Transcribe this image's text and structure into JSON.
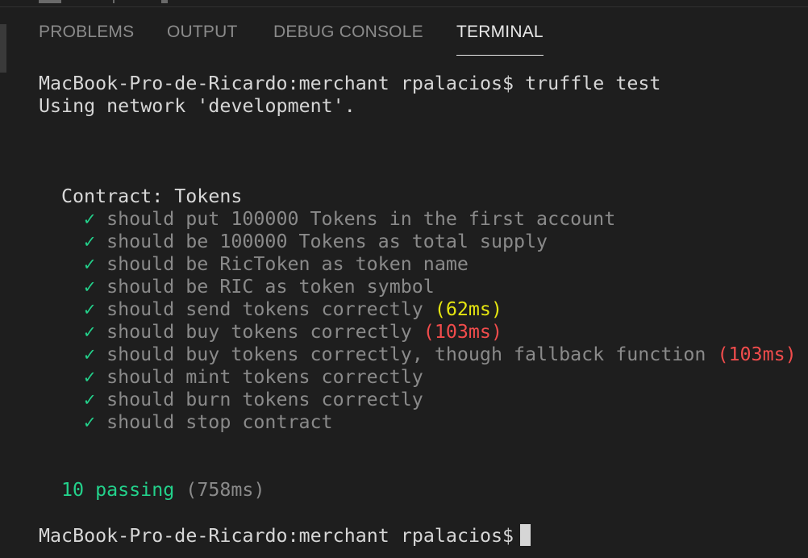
{
  "panel": {
    "tabs": [
      {
        "label": "PROBLEMS",
        "active": false
      },
      {
        "label": "OUTPUT",
        "active": false
      },
      {
        "label": "DEBUG CONSOLE",
        "active": false
      },
      {
        "label": "TERMINAL",
        "active": true
      }
    ]
  },
  "terminal": {
    "prompt": "MacBook-Pro-de-Ricardo:merchant rpalacios$",
    "command": "truffle test",
    "network_line": "Using network 'development'.",
    "suite_title": "Contract: Tokens",
    "check_glyph": "✓",
    "tests": [
      {
        "name": "should put 100000 Tokens in the first account",
        "duration": ""
      },
      {
        "name": "should be 100000 Tokens as total supply",
        "duration": ""
      },
      {
        "name": "should be RicToken as token name",
        "duration": ""
      },
      {
        "name": "should be RIC as token symbol",
        "duration": ""
      },
      {
        "name": "should send tokens correctly",
        "duration": "(62ms)"
      },
      {
        "name": "should buy tokens correctly",
        "duration": "(103ms)"
      },
      {
        "name": "should buy tokens correctly, though fallback function",
        "duration": "(103ms)"
      },
      {
        "name": "should mint tokens correctly",
        "duration": ""
      },
      {
        "name": "should burn tokens correctly",
        "duration": ""
      },
      {
        "name": "should stop contract",
        "duration": ""
      }
    ],
    "summary_passing": "10 passing",
    "summary_time": "(758ms)",
    "final_prompt": "MacBook-Pro-de-Ricardo:merchant rpalacios$"
  },
  "colors": {
    "background": "#1e1e1e",
    "text": "#d6d6d6",
    "pass_green": "#23d18b",
    "slow_yellow": "#e5e510",
    "slow_red": "#f14c4c",
    "dim_gray": "#8a8a8a"
  }
}
